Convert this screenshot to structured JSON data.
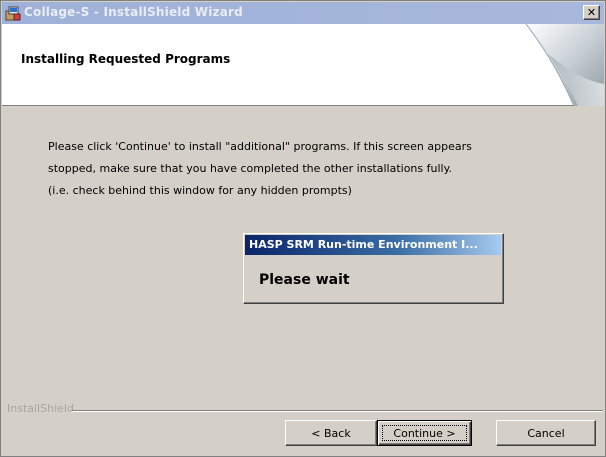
{
  "window": {
    "title": "Collage-S - InstallShield Wizard",
    "close_label": "✕"
  },
  "header": {
    "title": "Installing Requested Programs"
  },
  "body": {
    "lines": [
      "Please click 'Continue' to install \"additional\" programs.  If this screen appears",
      "stopped, make sure that you have completed the other installations fully.",
      "(i.e. check behind this window for any hidden prompts)"
    ]
  },
  "progress_dialog": {
    "title": "HASP SRM Run-time Environment I...",
    "message": "Please wait"
  },
  "footer": {
    "brand": "InstallShield",
    "back_label": "< Back",
    "continue_label": "Continue >",
    "cancel_label": "Cancel"
  }
}
